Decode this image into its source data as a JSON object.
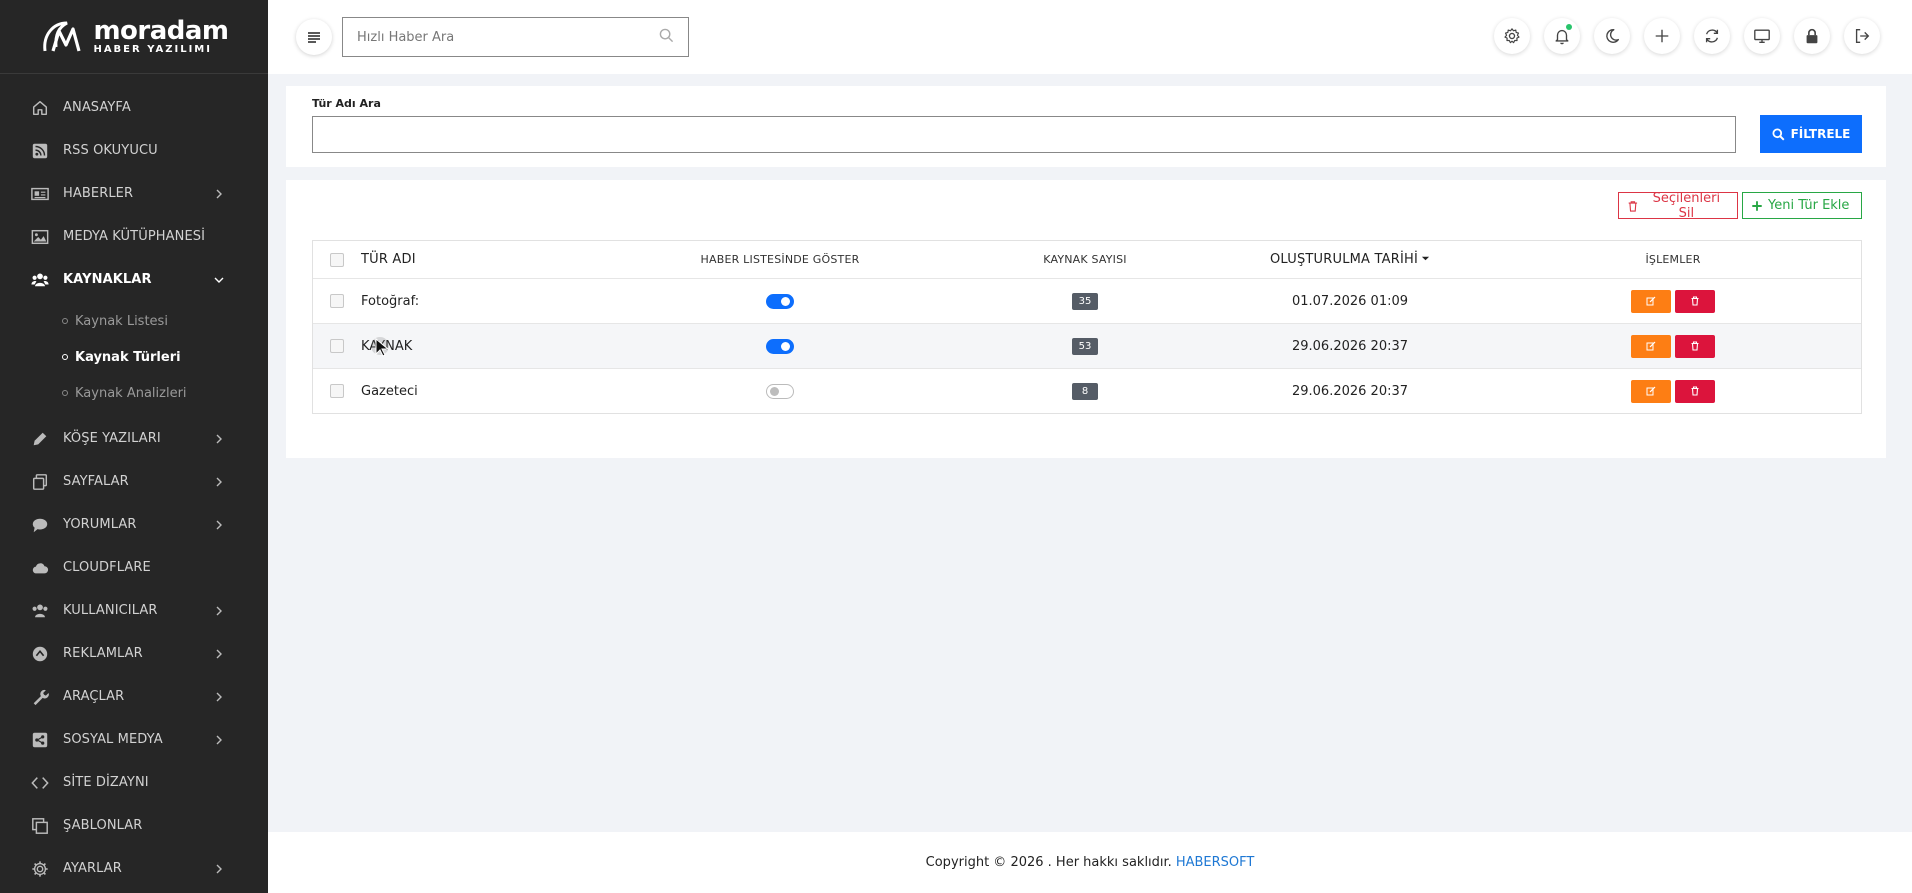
{
  "brand": {
    "name": "moradam",
    "tagline": "HABER YAZILIMI"
  },
  "sidebar": {
    "items": [
      {
        "label": "ANASAYFA",
        "icon": "home-icon",
        "has_children": false
      },
      {
        "label": "RSS OKUYUCU",
        "icon": "rss-icon",
        "has_children": false
      },
      {
        "label": "HABERLER",
        "icon": "newspaper-icon",
        "has_children": true
      },
      {
        "label": "MEDYA KÜTÜPHANESİ",
        "icon": "image-icon",
        "has_children": false
      },
      {
        "label": "KAYNAKLAR",
        "icon": "users-icon",
        "has_children": true,
        "expanded": true
      },
      {
        "label": "KÖŞE YAZILARI",
        "icon": "pencil-icon",
        "has_children": true
      },
      {
        "label": "SAYFALAR",
        "icon": "copy-icon",
        "has_children": true
      },
      {
        "label": "YORUMLAR",
        "icon": "comment-icon",
        "has_children": true
      },
      {
        "label": "CLOUDFLARE",
        "icon": "cloud-icon",
        "has_children": false
      },
      {
        "label": "KULLANICILAR",
        "icon": "users-icon",
        "has_children": true
      },
      {
        "label": "REKLAMLAR",
        "icon": "ad-icon",
        "has_children": true
      },
      {
        "label": "ARAÇLAR",
        "icon": "wrench-icon",
        "has_children": true
      },
      {
        "label": "SOSYAL MEDYA",
        "icon": "share-icon",
        "has_children": true
      },
      {
        "label": "SİTE DİZAYNI",
        "icon": "code-icon",
        "has_children": false
      },
      {
        "label": "ŞABLONLAR",
        "icon": "clone-icon",
        "has_children": false
      },
      {
        "label": "AYARLAR",
        "icon": "gear-icon",
        "has_children": true
      }
    ],
    "submenu": [
      {
        "label": "Kaynak Listesi",
        "active": false
      },
      {
        "label": "Kaynak Türleri",
        "active": true
      },
      {
        "label": "Kaynak Analizleri",
        "active": false
      }
    ]
  },
  "header": {
    "search_placeholder": "Hızlı Haber Ara",
    "icons": [
      "gear-icon",
      "bell-icon",
      "moon-icon",
      "plus-icon",
      "refresh-icon",
      "monitor-icon",
      "lock-icon",
      "logout-icon"
    ]
  },
  "filter": {
    "label": "Tür Adı Ara",
    "value": "",
    "button": "FİLTRELE"
  },
  "actions": {
    "delete_selected": "Seçilenleri Sil",
    "add_new": "Yeni Tür Ekle"
  },
  "table": {
    "columns": {
      "name": "TÜR ADI",
      "show": "HABER LISTESİNDE GÖSTER",
      "count": "KAYNAK SAYISI",
      "date": "OLUŞTURULMA TARİHİ",
      "ops": "İŞLEMLER"
    },
    "rows": [
      {
        "name": "Fotoğraf:",
        "show": true,
        "count": "35",
        "date": "01.07.2026 01:09"
      },
      {
        "name": "KAYNAK",
        "show": true,
        "count": "53",
        "date": "29.06.2026 20:37"
      },
      {
        "name": "Gazeteci",
        "show": false,
        "count": "8",
        "date": "29.06.2026 20:37"
      }
    ]
  },
  "footer": {
    "text": "Copyright © 2026 . Her hakkı saklıdır.",
    "link": "HABERSOFT"
  },
  "colors": {
    "sidebar_bg": "#262626",
    "primary": "#0d6efd",
    "danger": "#dc3545",
    "success": "#28a745",
    "edit": "#fd7e14"
  }
}
